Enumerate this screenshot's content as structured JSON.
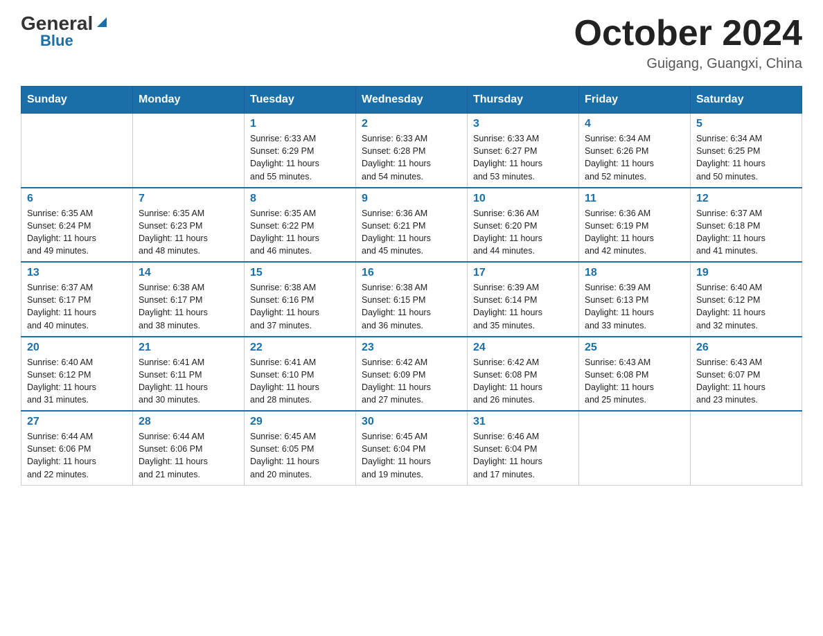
{
  "header": {
    "logo_general": "General",
    "logo_blue": "Blue",
    "month_title": "October 2024",
    "location": "Guigang, Guangxi, China"
  },
  "days_of_week": [
    "Sunday",
    "Monday",
    "Tuesday",
    "Wednesday",
    "Thursday",
    "Friday",
    "Saturday"
  ],
  "weeks": [
    [
      {
        "num": "",
        "info": ""
      },
      {
        "num": "",
        "info": ""
      },
      {
        "num": "1",
        "info": "Sunrise: 6:33 AM\nSunset: 6:29 PM\nDaylight: 11 hours\nand 55 minutes."
      },
      {
        "num": "2",
        "info": "Sunrise: 6:33 AM\nSunset: 6:28 PM\nDaylight: 11 hours\nand 54 minutes."
      },
      {
        "num": "3",
        "info": "Sunrise: 6:33 AM\nSunset: 6:27 PM\nDaylight: 11 hours\nand 53 minutes."
      },
      {
        "num": "4",
        "info": "Sunrise: 6:34 AM\nSunset: 6:26 PM\nDaylight: 11 hours\nand 52 minutes."
      },
      {
        "num": "5",
        "info": "Sunrise: 6:34 AM\nSunset: 6:25 PM\nDaylight: 11 hours\nand 50 minutes."
      }
    ],
    [
      {
        "num": "6",
        "info": "Sunrise: 6:35 AM\nSunset: 6:24 PM\nDaylight: 11 hours\nand 49 minutes."
      },
      {
        "num": "7",
        "info": "Sunrise: 6:35 AM\nSunset: 6:23 PM\nDaylight: 11 hours\nand 48 minutes."
      },
      {
        "num": "8",
        "info": "Sunrise: 6:35 AM\nSunset: 6:22 PM\nDaylight: 11 hours\nand 46 minutes."
      },
      {
        "num": "9",
        "info": "Sunrise: 6:36 AM\nSunset: 6:21 PM\nDaylight: 11 hours\nand 45 minutes."
      },
      {
        "num": "10",
        "info": "Sunrise: 6:36 AM\nSunset: 6:20 PM\nDaylight: 11 hours\nand 44 minutes."
      },
      {
        "num": "11",
        "info": "Sunrise: 6:36 AM\nSunset: 6:19 PM\nDaylight: 11 hours\nand 42 minutes."
      },
      {
        "num": "12",
        "info": "Sunrise: 6:37 AM\nSunset: 6:18 PM\nDaylight: 11 hours\nand 41 minutes."
      }
    ],
    [
      {
        "num": "13",
        "info": "Sunrise: 6:37 AM\nSunset: 6:17 PM\nDaylight: 11 hours\nand 40 minutes."
      },
      {
        "num": "14",
        "info": "Sunrise: 6:38 AM\nSunset: 6:17 PM\nDaylight: 11 hours\nand 38 minutes."
      },
      {
        "num": "15",
        "info": "Sunrise: 6:38 AM\nSunset: 6:16 PM\nDaylight: 11 hours\nand 37 minutes."
      },
      {
        "num": "16",
        "info": "Sunrise: 6:38 AM\nSunset: 6:15 PM\nDaylight: 11 hours\nand 36 minutes."
      },
      {
        "num": "17",
        "info": "Sunrise: 6:39 AM\nSunset: 6:14 PM\nDaylight: 11 hours\nand 35 minutes."
      },
      {
        "num": "18",
        "info": "Sunrise: 6:39 AM\nSunset: 6:13 PM\nDaylight: 11 hours\nand 33 minutes."
      },
      {
        "num": "19",
        "info": "Sunrise: 6:40 AM\nSunset: 6:12 PM\nDaylight: 11 hours\nand 32 minutes."
      }
    ],
    [
      {
        "num": "20",
        "info": "Sunrise: 6:40 AM\nSunset: 6:12 PM\nDaylight: 11 hours\nand 31 minutes."
      },
      {
        "num": "21",
        "info": "Sunrise: 6:41 AM\nSunset: 6:11 PM\nDaylight: 11 hours\nand 30 minutes."
      },
      {
        "num": "22",
        "info": "Sunrise: 6:41 AM\nSunset: 6:10 PM\nDaylight: 11 hours\nand 28 minutes."
      },
      {
        "num": "23",
        "info": "Sunrise: 6:42 AM\nSunset: 6:09 PM\nDaylight: 11 hours\nand 27 minutes."
      },
      {
        "num": "24",
        "info": "Sunrise: 6:42 AM\nSunset: 6:08 PM\nDaylight: 11 hours\nand 26 minutes."
      },
      {
        "num": "25",
        "info": "Sunrise: 6:43 AM\nSunset: 6:08 PM\nDaylight: 11 hours\nand 25 minutes."
      },
      {
        "num": "26",
        "info": "Sunrise: 6:43 AM\nSunset: 6:07 PM\nDaylight: 11 hours\nand 23 minutes."
      }
    ],
    [
      {
        "num": "27",
        "info": "Sunrise: 6:44 AM\nSunset: 6:06 PM\nDaylight: 11 hours\nand 22 minutes."
      },
      {
        "num": "28",
        "info": "Sunrise: 6:44 AM\nSunset: 6:06 PM\nDaylight: 11 hours\nand 21 minutes."
      },
      {
        "num": "29",
        "info": "Sunrise: 6:45 AM\nSunset: 6:05 PM\nDaylight: 11 hours\nand 20 minutes."
      },
      {
        "num": "30",
        "info": "Sunrise: 6:45 AM\nSunset: 6:04 PM\nDaylight: 11 hours\nand 19 minutes."
      },
      {
        "num": "31",
        "info": "Sunrise: 6:46 AM\nSunset: 6:04 PM\nDaylight: 11 hours\nand 17 minutes."
      },
      {
        "num": "",
        "info": ""
      },
      {
        "num": "",
        "info": ""
      }
    ]
  ]
}
